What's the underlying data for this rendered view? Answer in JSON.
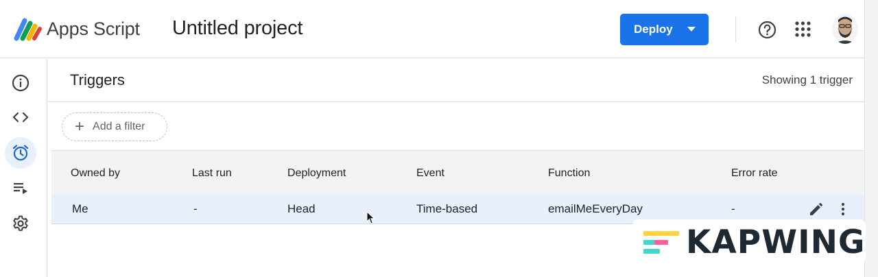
{
  "header": {
    "app_name": "Apps Script",
    "project_title": "Untitled project",
    "deploy_label": "Deploy"
  },
  "rail": {
    "items": [
      {
        "name": "overview",
        "icon": "info-icon"
      },
      {
        "name": "editor",
        "icon": "code-icon"
      },
      {
        "name": "triggers",
        "icon": "alarm-clock-icon",
        "active": true
      },
      {
        "name": "executions",
        "icon": "playlist-play-icon"
      },
      {
        "name": "project-settings",
        "icon": "gear-icon"
      }
    ]
  },
  "main": {
    "title": "Triggers",
    "showing": "Showing 1 trigger",
    "filter_label": "Add a filter"
  },
  "table": {
    "columns": [
      "Owned by",
      "Last run",
      "Deployment",
      "Event",
      "Function",
      "Error rate"
    ],
    "rows": [
      [
        "Me",
        "-",
        "Head",
        "Time-based",
        "emailMeEveryDay",
        "-"
      ]
    ]
  },
  "watermark": {
    "text": "KAPWING"
  },
  "colors": {
    "accent": "#1a73e8",
    "active_rail_bg": "#e8f0fe",
    "row_selected_bg": "#e8f0fe",
    "table_header_bg": "#f1f3f4"
  }
}
